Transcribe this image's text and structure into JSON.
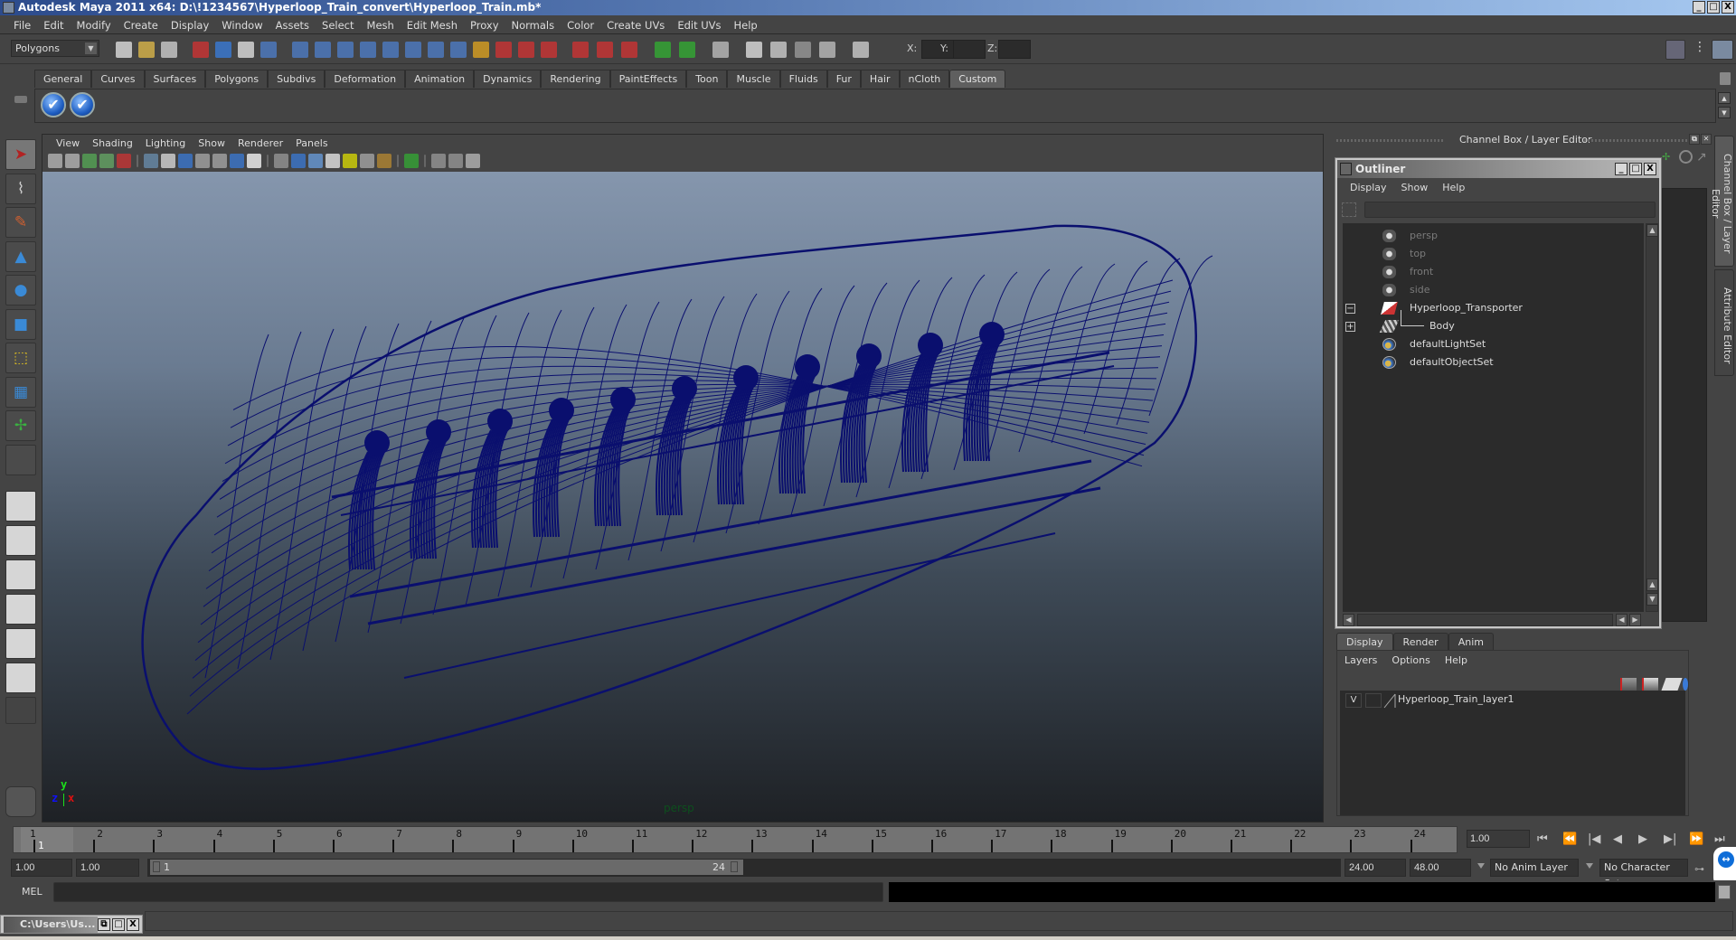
{
  "window": {
    "title": "Autodesk Maya 2011 x64: D:\\!1234567\\Hyperloop_Train_convert\\Hyperloop_Train.mb*",
    "controls": [
      "_",
      "□",
      "X"
    ]
  },
  "menubar": [
    "File",
    "Edit",
    "Modify",
    "Create",
    "Display",
    "Window",
    "Assets",
    "Select",
    "Mesh",
    "Edit Mesh",
    "Proxy",
    "Normals",
    "Color",
    "Create UVs",
    "Edit UVs",
    "Help"
  ],
  "statusline": {
    "mode": "Polygons",
    "coord_labels": [
      "X:",
      "Y:",
      "Z:"
    ],
    "coord_values": [
      "",
      "",
      ""
    ]
  },
  "shelf": {
    "tabs": [
      "General",
      "Curves",
      "Surfaces",
      "Polygons",
      "Subdivs",
      "Deformation",
      "Animation",
      "Dynamics",
      "Rendering",
      "PaintEffects",
      "Toon",
      "Muscle",
      "Fluids",
      "Fur",
      "Hair",
      "nCloth",
      "Custom"
    ],
    "active_tab": "Custom",
    "buttons": [
      {
        "icon": "checkmark-icon",
        "glyph": "✔"
      },
      {
        "icon": "checkmark-icon",
        "glyph": "✔"
      }
    ]
  },
  "toolbox": {
    "tools": [
      {
        "name": "select-tool",
        "glyph": "➤",
        "color": "#b22222"
      },
      {
        "name": "lasso-tool",
        "glyph": "⌇",
        "color": "#cccccc"
      },
      {
        "name": "paint-select-tool",
        "glyph": "✎",
        "color": "#d06030"
      },
      {
        "name": "move-tool",
        "glyph": "▲",
        "color": "#3a8ad6"
      },
      {
        "name": "rotate-tool",
        "glyph": "●",
        "color": "#3a8ad6"
      },
      {
        "name": "scale-tool",
        "glyph": "■",
        "color": "#3a8ad6"
      },
      {
        "name": "universal-manipulator",
        "glyph": "⬚",
        "color": "#e0c020"
      },
      {
        "name": "soft-modification-tool",
        "glyph": "▦",
        "color": "#3a8ad6"
      },
      {
        "name": "show-manipulator-tool",
        "glyph": "✢",
        "color": "#3ab040"
      },
      {
        "name": "last-tool-used",
        "glyph": "",
        "color": "#cccccc"
      }
    ]
  },
  "viewport": {
    "menu": [
      "View",
      "Shading",
      "Lighting",
      "Show",
      "Renderer",
      "Panels"
    ],
    "camera": "persp",
    "axis": {
      "x": "x",
      "y": "y",
      "z": "z"
    },
    "wire_color": "#0a0f6e"
  },
  "channelbox": {
    "header": "Channel Box / Layer Editor",
    "side_tabs": [
      "Channel Box / Layer Editor",
      "Attribute Editor"
    ]
  },
  "outliner": {
    "title": "Outliner",
    "menu": [
      "Display",
      "Show",
      "Help"
    ],
    "filter_value": "",
    "items": [
      {
        "label": "persp",
        "icon": "camera-icon",
        "dim": true,
        "expander": ""
      },
      {
        "label": "top",
        "icon": "camera-icon",
        "dim": true,
        "expander": ""
      },
      {
        "label": "front",
        "icon": "camera-icon",
        "dim": true,
        "expander": ""
      },
      {
        "label": "side",
        "icon": "camera-icon",
        "dim": true,
        "expander": ""
      },
      {
        "label": "Hyperloop_Transporter",
        "icon": "transform-icon",
        "dim": false,
        "expander": "−"
      },
      {
        "label": "Body",
        "icon": "mesh-icon",
        "dim": false,
        "expander": "+"
      },
      {
        "label": "defaultLightSet",
        "icon": "set-icon",
        "dim": false,
        "expander": ""
      },
      {
        "label": "defaultObjectSet",
        "icon": "set-icon",
        "dim": false,
        "expander": ""
      }
    ]
  },
  "layereditor": {
    "tabs": [
      "Display",
      "Render",
      "Anim"
    ],
    "active_tab": "Display",
    "menu": [
      "Layers",
      "Options",
      "Help"
    ],
    "layers": [
      {
        "visible": "V",
        "type": "",
        "name": "Hyperloop_Train_layer1"
      }
    ]
  },
  "timeslider": {
    "start": 1,
    "end": 24,
    "current_frame": 1,
    "current_label": "1",
    "current_field": "1.00",
    "ticks": [
      "1",
      "2",
      "3",
      "4",
      "5",
      "6",
      "7",
      "8",
      "9",
      "10",
      "11",
      "12",
      "13",
      "14",
      "15",
      "16",
      "17",
      "18",
      "19",
      "20",
      "21",
      "22",
      "23",
      "24"
    ],
    "playback": [
      "⏮",
      "⏪",
      "|◀",
      "◀",
      "▶",
      "▶|",
      "⏩",
      "⏭"
    ]
  },
  "rangeslider": {
    "start_time": "1.00",
    "playback_start": "1.00",
    "range_start_label": "1",
    "range_end_label": "24",
    "playback_end": "24.00",
    "end_time": "48.00",
    "anim_layer": "No Anim Layer",
    "character_set": "No Character Set"
  },
  "commandline": {
    "label": "MEL",
    "input": "",
    "output": ""
  },
  "minimized_window": {
    "title": "C:\\Users\\Us..."
  }
}
